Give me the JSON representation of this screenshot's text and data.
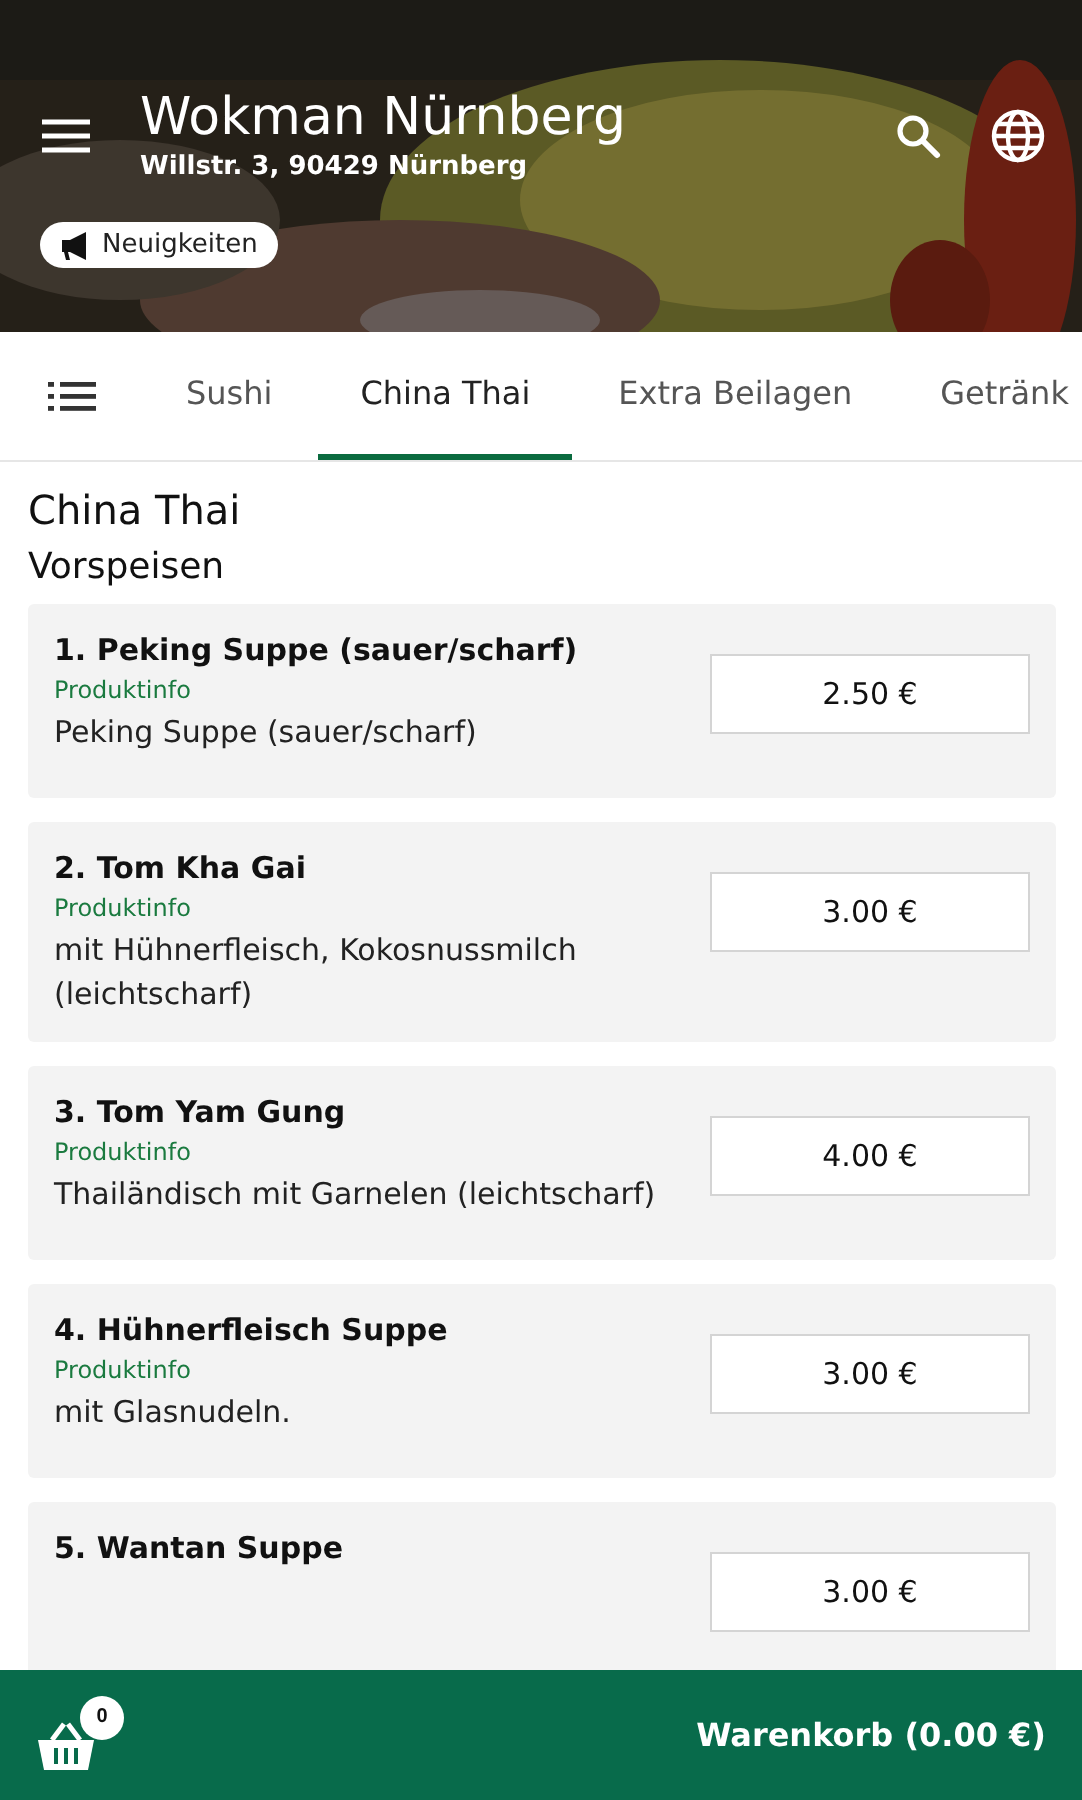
{
  "header": {
    "title": "Wokman Nürnberg",
    "address": "Willstr. 3, 90429 Nürnberg",
    "news_button": "Neuigkeiten"
  },
  "tabs": [
    {
      "label": "Sushi",
      "selected": false
    },
    {
      "label": "China Thai",
      "selected": true
    },
    {
      "label": "Extra Beilagen",
      "selected": false
    },
    {
      "label": "Getränk",
      "selected": false
    }
  ],
  "category": "China Thai",
  "section": "Vorspeisen",
  "products": [
    {
      "name": "1. Peking Suppe (sauer/scharf)",
      "info_link": "Produktinfo",
      "description": "Peking Suppe (sauer/scharf)",
      "price": "2.50 €"
    },
    {
      "name": "2. Tom Kha Gai",
      "info_link": "Produktinfo",
      "description": "mit Hühnerfleisch, Kokosnussmilch (leichtscharf)",
      "price": "3.00 €"
    },
    {
      "name": "3. Tom Yam Gung",
      "info_link": "Produktinfo",
      "description": "Thailändisch mit Garnelen (leichtscharf)",
      "price": "4.00 €"
    },
    {
      "name": "4. Hühnerfleisch Suppe",
      "info_link": "Produktinfo",
      "description": "mit Glasnudeln.",
      "price": "3.00 €"
    },
    {
      "name": "5. Wantan Suppe",
      "price": "3.00 €"
    }
  ],
  "cart": {
    "count": "0",
    "label": "Warenkorb (0.00 €)"
  }
}
